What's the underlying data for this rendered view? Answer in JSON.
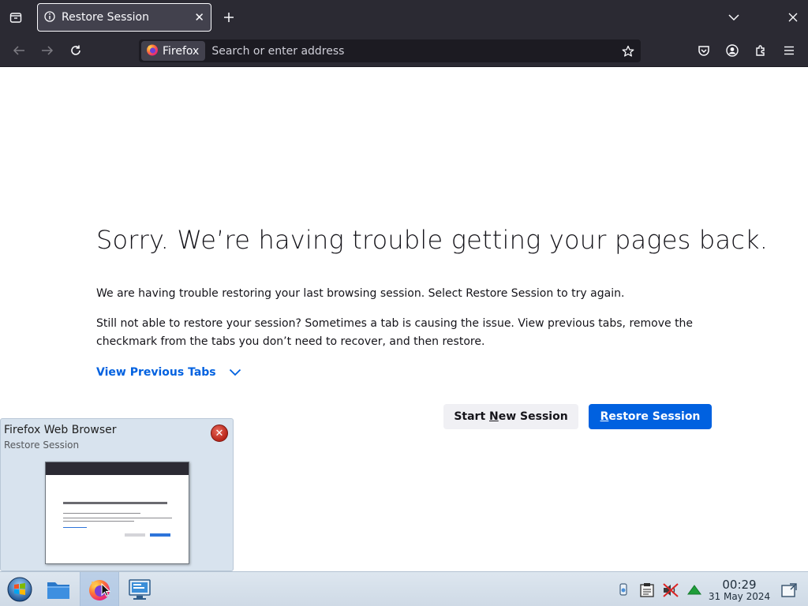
{
  "browser": {
    "tab": {
      "title": "Restore Session"
    },
    "urlbar": {
      "identity_label": "Firefox",
      "placeholder": "Search or enter address"
    }
  },
  "page": {
    "headline": "Sorry. We’re having trouble getting your pages back.",
    "para1": "We are having trouble restoring your last browsing session. Select Restore Session to try again.",
    "para2": "Still not able to restore your session? Sometimes a tab is causing the issue. View previous tabs, remove the checkmark from the tabs you don’t need to recover, and then restore.",
    "view_previous_tabs": "View Previous Tabs",
    "start_new_session": {
      "accesskey": "N",
      "before": "Start ",
      "rest": "ew Session"
    },
    "restore_session": {
      "accesskey": "R",
      "rest": "estore Session"
    }
  },
  "popup": {
    "title": "Firefox Web Browser",
    "subtitle": "Restore Session"
  },
  "taskbar": {
    "clock_time": "00:29",
    "clock_date": "31 May 2024",
    "items": [
      "start-menu-icon",
      "file-manager-icon",
      "firefox-icon",
      "system-settings-icon"
    ],
    "tray": [
      "network-icon",
      "clipboard-icon",
      "volume-muted-icon",
      "update-arrow-icon",
      "show-desktop-icon"
    ]
  },
  "colors": {
    "chrome": "#2b2a33",
    "accent": "#0061e0",
    "taskbar": "#d5dfea"
  }
}
